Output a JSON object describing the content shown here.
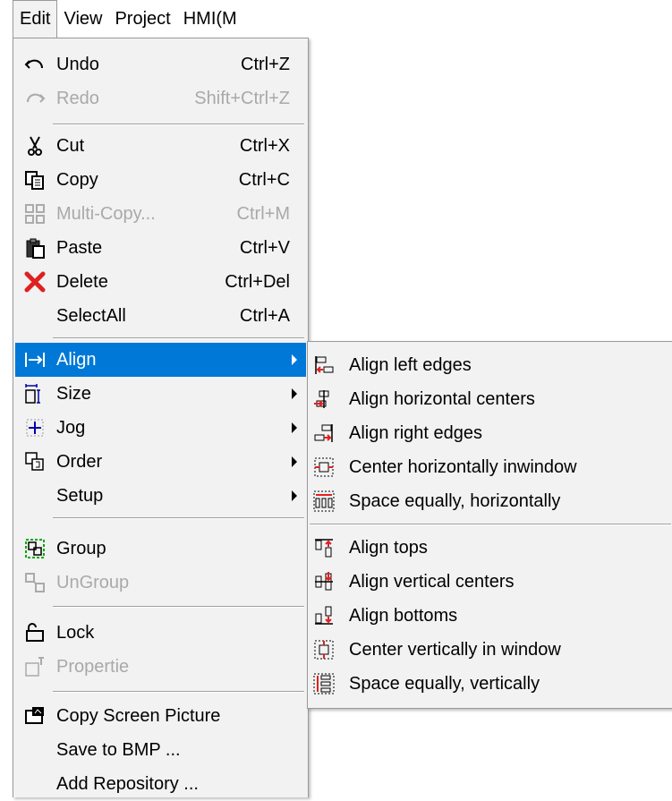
{
  "menubar": [
    "Edit",
    "View",
    "Project",
    "HMI(M"
  ],
  "edit_menu": {
    "items": [
      {
        "label": "Undo",
        "shortcut": "Ctrl+Z",
        "icon": "undo-icon",
        "disabled": false
      },
      {
        "label": "Redo",
        "shortcut": "Shift+Ctrl+Z",
        "icon": "redo-icon",
        "disabled": true
      },
      {
        "label": "Cut",
        "shortcut": "Ctrl+X",
        "icon": "scissors-icon",
        "disabled": false
      },
      {
        "label": "Copy",
        "shortcut": "Ctrl+C",
        "icon": "copy-icon",
        "disabled": false
      },
      {
        "label": "Multi-Copy...",
        "shortcut": "Ctrl+M",
        "icon": "multi-copy-icon",
        "disabled": true
      },
      {
        "label": "Paste",
        "shortcut": "Ctrl+V",
        "icon": "paste-icon",
        "disabled": false
      },
      {
        "label": "Delete",
        "shortcut": "Ctrl+Del",
        "icon": "delete-icon",
        "disabled": false
      },
      {
        "label": "SelectAll",
        "shortcut": "Ctrl+A",
        "icon": "",
        "disabled": false
      },
      {
        "label": "Align",
        "shortcut": "",
        "icon": "align-icon",
        "submenu": true,
        "selected": true
      },
      {
        "label": "Size",
        "shortcut": "",
        "icon": "size-icon",
        "submenu": true
      },
      {
        "label": "Jog",
        "shortcut": "",
        "icon": "jog-icon",
        "submenu": true
      },
      {
        "label": "Order",
        "shortcut": "",
        "icon": "order-icon",
        "submenu": true
      },
      {
        "label": "Setup",
        "shortcut": "",
        "icon": "",
        "submenu": true
      },
      {
        "label": "Group",
        "shortcut": "",
        "icon": "group-icon",
        "disabled": false
      },
      {
        "label": "UnGroup",
        "shortcut": "",
        "icon": "ungroup-icon",
        "disabled": true
      },
      {
        "label": "Lock",
        "shortcut": "",
        "icon": "lock-icon",
        "disabled": false
      },
      {
        "label": "Propertie",
        "shortcut": "",
        "icon": "properties-icon",
        "disabled": true
      },
      {
        "label": "Copy Screen Picture",
        "shortcut": "",
        "icon": "screen-picture-icon",
        "disabled": false
      },
      {
        "label": "Save to BMP ...",
        "shortcut": "",
        "icon": "",
        "disabled": false
      },
      {
        "label": "Add Repository ...",
        "shortcut": "",
        "icon": "",
        "disabled": false
      }
    ]
  },
  "align_submenu": {
    "items": [
      {
        "label": "Align left edges",
        "icon": "align-left-edges-icon"
      },
      {
        "label": "Align horizontal centers",
        "icon": "align-horizontal-centers-icon"
      },
      {
        "label": "Align right edges",
        "icon": "align-right-edges-icon"
      },
      {
        "label": "Center horizontally inwindow",
        "icon": "center-horizontally-icon"
      },
      {
        "label": "Space equally, horizontally",
        "icon": "space-horizontally-icon"
      },
      {
        "label": "Align tops",
        "icon": "align-tops-icon"
      },
      {
        "label": "Align vertical centers",
        "icon": "align-vertical-centers-icon"
      },
      {
        "label": "Align bottoms",
        "icon": "align-bottoms-icon"
      },
      {
        "label": "Center vertically in window",
        "icon": "center-vertically-icon"
      },
      {
        "label": "Space equally, vertically",
        "icon": "space-vertically-icon"
      }
    ]
  },
  "colors": {
    "selection": "#0078d7",
    "menu_bg": "#f2f2f2",
    "disabled_text": "#a9a9a9",
    "accent_red": "#e02020"
  }
}
